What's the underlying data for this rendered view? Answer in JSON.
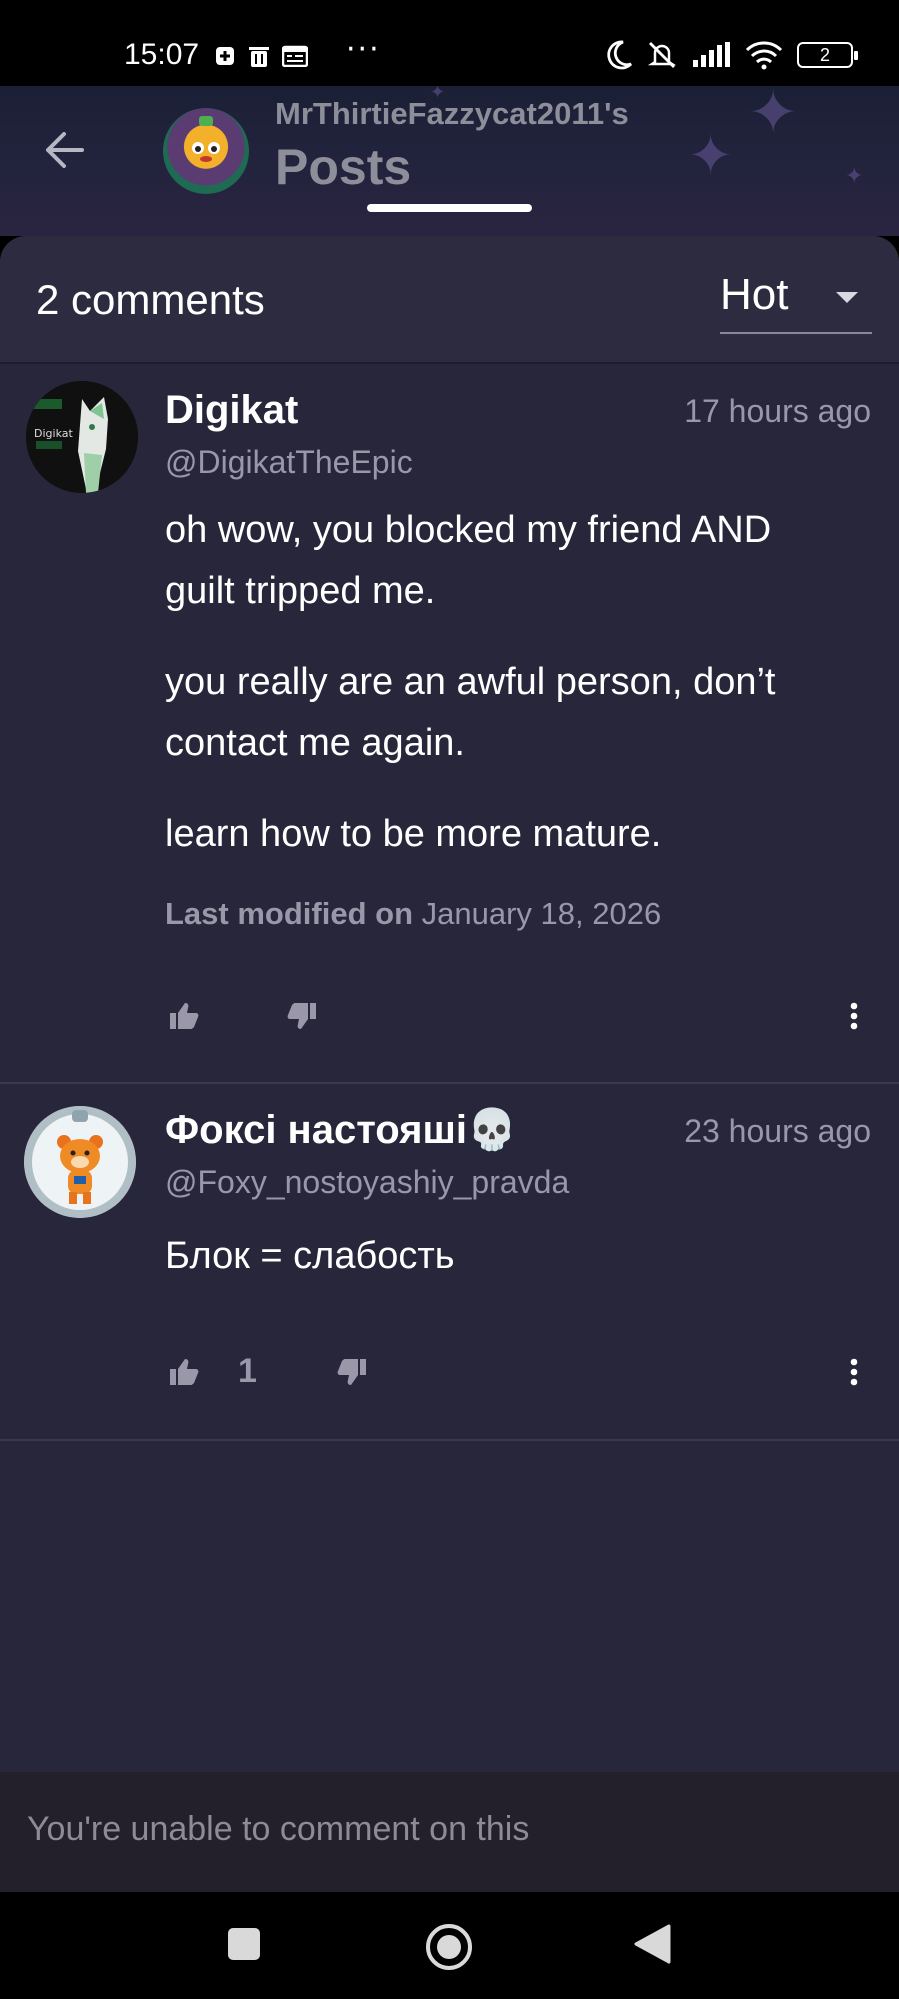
{
  "status_bar": {
    "time": "15:07",
    "more": "···",
    "battery": "2",
    "icons": [
      "plus-square-icon",
      "trash-icon",
      "calendar-icon",
      "moon-icon",
      "bell-off-icon",
      "signal-icon",
      "wifi-icon",
      "battery-icon"
    ]
  },
  "header": {
    "subtitle": "MrThirtieFazzycat2011's",
    "title": "Posts",
    "back_icon": "arrow-left-icon"
  },
  "comments_bar": {
    "count_label": "2 comments",
    "sort_label": "Hot"
  },
  "comments": [
    {
      "name": "Digikat",
      "handle": "@DigikatTheEpic",
      "time": "17 hours ago",
      "avatar_label": "Digikat",
      "paragraphs": [
        "oh wow, you blocked my friend AND guilt tripped me.",
        "you really are an awful person, don’t contact me again.",
        "learn how to be more mature."
      ],
      "modified_label": "Last modified on",
      "modified_date": "January 18, 2026",
      "likes": ""
    },
    {
      "name": "Фоксі настояші💀",
      "handle": "@Foxy_nostoyashiy_pravda",
      "time": "23 hours ago",
      "paragraphs": [
        "Блок = слабость"
      ],
      "likes": "1"
    }
  ],
  "footer": {
    "unable_text": "You're unable to comment on this"
  },
  "colors": {
    "panel_bg": "#28263a",
    "muted_text": "#9a98a8",
    "footer_bg": "#231f2b"
  }
}
